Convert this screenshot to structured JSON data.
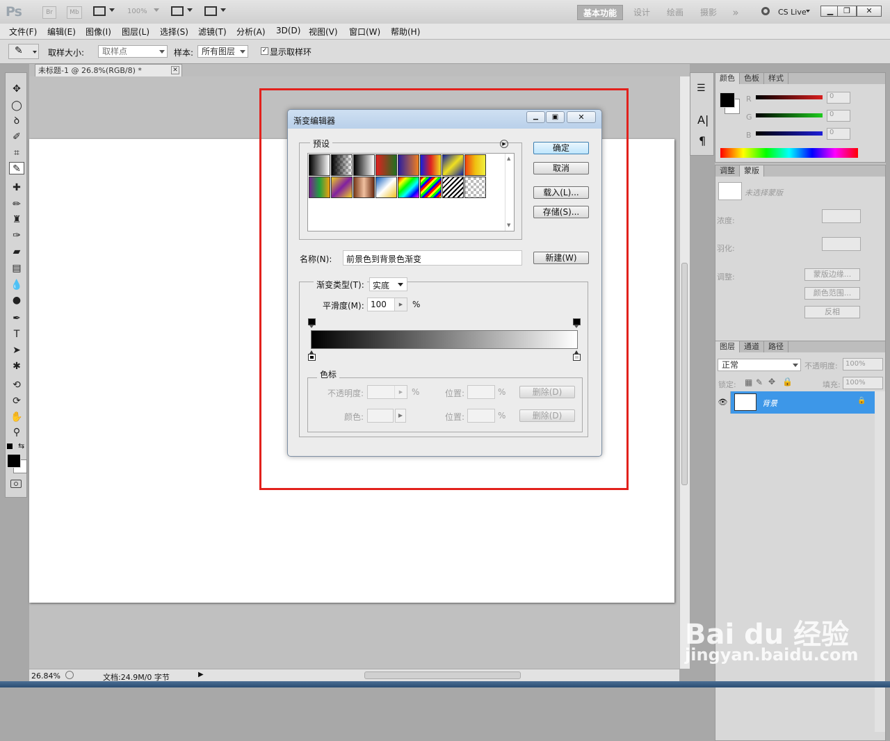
{
  "app": {
    "logo": "Ps",
    "chips": [
      "Br",
      "Mb"
    ],
    "zoom": "100%",
    "workspaces": [
      {
        "label": "基本功能",
        "active": true
      },
      {
        "label": "设计",
        "active": false
      },
      {
        "label": "绘画",
        "active": false
      },
      {
        "label": "摄影",
        "active": false
      }
    ],
    "more": "»",
    "cslive": "CS Live"
  },
  "menus": [
    "文件(F)",
    "编辑(E)",
    "图像(I)",
    "图层(L)",
    "选择(S)",
    "滤镜(T)",
    "分析(A)",
    "3D(D)",
    "视图(V)",
    "窗口(W)",
    "帮助(H)"
  ],
  "options": {
    "size_label": "取样大小:",
    "size_value": "取样点",
    "sample_label": "样本:",
    "sample_value": "所有图层",
    "ring_label": "显示取样环",
    "ring_checked": true
  },
  "document": {
    "tab_title": "未标题-1 @ 26.8%(RGB/8) *",
    "zoom": "26.84%",
    "doc_info": "文档:24.9M/0 字节"
  },
  "panels": {
    "color_tabs": [
      "颜色",
      "色板",
      "样式"
    ],
    "channels": [
      {
        "name": "R",
        "value": "0",
        "color": "#d81e1e"
      },
      {
        "name": "G",
        "value": "0",
        "color": "#1ecb1e"
      },
      {
        "name": "B",
        "value": "0",
        "color": "#1e1ed8"
      }
    ],
    "adjust_tabs": [
      "调整",
      "蒙版"
    ],
    "mask_status": "未选择蒙版",
    "density_label": "浓度:",
    "feather_label": "羽化:",
    "adjust_label": "调整:",
    "mask_edge_button": "蒙版边缘...",
    "color_range_button": "颜色范围...",
    "invert_button": "反相",
    "layers_tabs": [
      "图层",
      "通道",
      "路径"
    ],
    "blend_mode": "正常",
    "opacity_label": "不透明度:",
    "opacity_value": "100%",
    "lock_label": "锁定:",
    "fill_label": "填充:",
    "fill_value": "100%",
    "layer_name": "背景"
  },
  "dialog": {
    "title": "渐变编辑器",
    "presets_label": "预设",
    "ok_button": "确定",
    "cancel_button": "取消",
    "load_button": "载入(L)...",
    "save_button": "存储(S)...",
    "name_label": "名称(N):",
    "name_value": "前景色到背景色渐变",
    "new_button": "新建(W)",
    "type_label": "渐变类型(T):",
    "type_value": "实底",
    "smooth_label": "平滑度(M):",
    "smooth_value": "100",
    "smooth_unit": "%",
    "stops_label": "色标",
    "opacity_label": "不透明度:",
    "location_label": "位置:",
    "color_label": "颜色:",
    "delete_button": "删除(D)",
    "percent": "%"
  },
  "watermark": {
    "brand": "Bai du 经验",
    "url": "jingyan.baidu.com"
  }
}
